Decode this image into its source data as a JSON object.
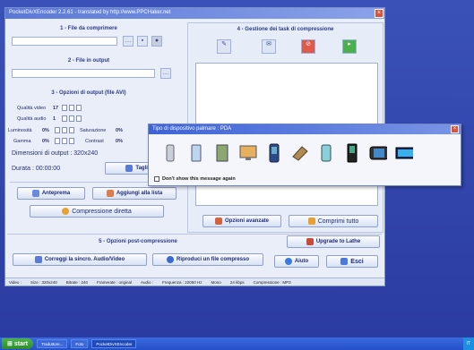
{
  "window": {
    "title": "PocketDivXEncoder 2.2.61 - translated by http://www.PPCHaker.net"
  },
  "left": {
    "section1_title": "1 - File da comprimere",
    "section2_title": "2 - File in output",
    "section3_title": "3 - Opzioni di output (file AVI)",
    "quality_video_label": "Qualità video",
    "quality_video_value": "17",
    "quality_audio_label": "Qualità audio",
    "quality_audio_value": "1",
    "luminosity_label": "Luminosità",
    "luminosity_value": "0%",
    "saturation_label": "Saturazione",
    "saturation_value": "0%",
    "gamma_label": "Gamma",
    "gamma_value": "0%",
    "contrast_label": "Contrast",
    "contrast_value": "0%",
    "dimensions_label": "Dimensioni di output : 320x240",
    "duration_label": "Durata : 00:00:00",
    "cut_button": "Taglia fi",
    "preview_button": "Anteprema",
    "add_list_button": "Aggiungi alla lista",
    "direct_button": "Compressione diretta",
    "section5_title": "5 - Opzioni post-compressione",
    "sync_button": "Correggi la sincro. Audio/Video",
    "play_button": "Riproduci un file compresso"
  },
  "right": {
    "section4_title": "4 - Gestione dei task di compressione",
    "advanced_button": "Opzioni avanzate",
    "compress_all_button": "Comprimi tutto",
    "upgrade_button": "Upgrade to Lathe",
    "help_button": "Aiuto",
    "exit_button": "Esci"
  },
  "status": {
    "video": "Video :",
    "size": "Size : 320x240",
    "bitrate": "Bitrate : 240",
    "framerate": "Framerate : original",
    "audio": "Audio :",
    "freq": "Frequenza : 22050 Hz",
    "mono": "Mono",
    "kbps": "24 kbps",
    "compression": "Compressione : MP3"
  },
  "popup": {
    "title": "Tipo di dispositivo palmare : PDA",
    "checkbox_label": "Don't show this message again",
    "devices": [
      "pda-device-icon",
      "phone-device-icon",
      "tablet-device-icon",
      "monitor-device-icon",
      "smartphone-device-icon",
      "handheld-device-icon",
      "pocketpc-device-icon",
      "cellphone-device-icon",
      "mediaplayer-device-icon",
      "widescreen-device-icon"
    ]
  },
  "taskbar": {
    "start_label": "start",
    "items": [
      "Traduttore...",
      "Foto",
      "PocketDivXEncoder"
    ],
    "clock": "IT"
  }
}
